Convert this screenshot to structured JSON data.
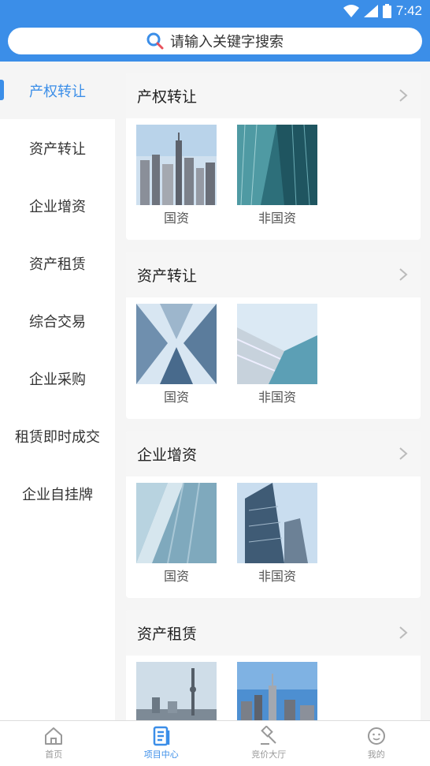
{
  "status": {
    "time": "7:42"
  },
  "search": {
    "placeholder": "请输入关键字搜索"
  },
  "sidebar": {
    "items": [
      {
        "label": "产权转让"
      },
      {
        "label": "资产转让"
      },
      {
        "label": "企业增资"
      },
      {
        "label": "资产租赁"
      },
      {
        "label": "综合交易"
      },
      {
        "label": "企业采购"
      },
      {
        "label": "租赁即时成交"
      },
      {
        "label": "企业自挂牌"
      }
    ]
  },
  "sections": [
    {
      "title": "产权转让",
      "tiles": [
        {
          "label": "国资"
        },
        {
          "label": "非国资"
        }
      ]
    },
    {
      "title": "资产转让",
      "tiles": [
        {
          "label": "国资"
        },
        {
          "label": "非国资"
        }
      ]
    },
    {
      "title": "企业增资",
      "tiles": [
        {
          "label": "国资"
        },
        {
          "label": "非国资"
        }
      ]
    },
    {
      "title": "资产租赁",
      "tiles": [
        {
          "label": ""
        },
        {
          "label": ""
        }
      ]
    }
  ],
  "tabbar": {
    "items": [
      {
        "label": "首页",
        "icon": "home-icon"
      },
      {
        "label": "项目中心",
        "icon": "document-icon"
      },
      {
        "label": "竞价大厅",
        "icon": "gavel-icon"
      },
      {
        "label": "我的",
        "icon": "smile-icon"
      }
    ]
  },
  "colors": {
    "primary": "#3b8ee8"
  }
}
